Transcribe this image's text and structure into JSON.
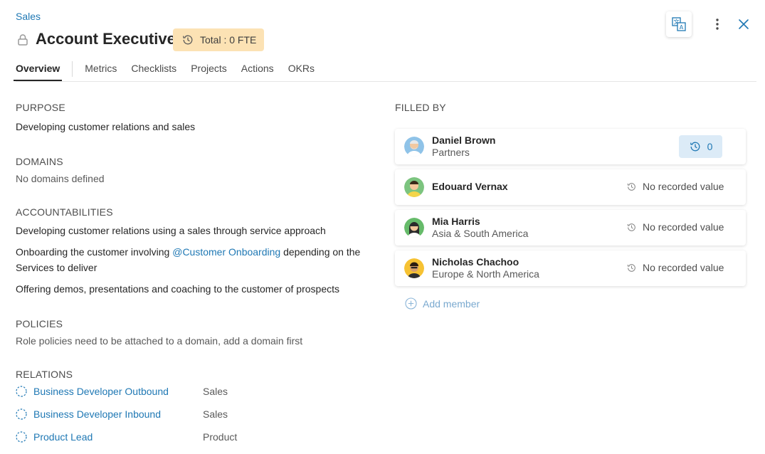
{
  "header": {
    "breadcrumb": "Sales",
    "title": "Account Executive",
    "fte_badge": "Total : 0 FTE"
  },
  "tabs": [
    {
      "label": "Overview",
      "active": true
    },
    {
      "label": "Metrics"
    },
    {
      "label": "Checklists"
    },
    {
      "label": "Projects"
    },
    {
      "label": "Actions"
    },
    {
      "label": "OKRs"
    }
  ],
  "purpose": {
    "heading": "PURPOSE",
    "text": "Developing customer relations and sales"
  },
  "domains": {
    "heading": "DOMAINS",
    "text": "No domains defined"
  },
  "accountabilities": {
    "heading": "ACCOUNTABILITIES",
    "item1": "Developing customer relations using a sales through service approach",
    "item2_before": "Onboarding the customer involving ",
    "item2_link": "@Customer Onboarding",
    "item2_after": " depending on the Services to deliver",
    "item3": "Offering demos, presentations and coaching to the customer of prospects"
  },
  "policies": {
    "heading": "POLICIES",
    "text": "Role policies need to be attached to a domain, add a domain first"
  },
  "relations": {
    "heading": "RELATIONS",
    "items": [
      {
        "role": "Business Developer Outbound",
        "circle": "Sales"
      },
      {
        "role": "Business Developer Inbound",
        "circle": "Sales"
      },
      {
        "role": "Product Lead",
        "circle": "Product"
      }
    ]
  },
  "filled_by": {
    "heading": "FILLED BY",
    "members": [
      {
        "name": "Daniel Brown",
        "sub": "Partners",
        "value": "0"
      },
      {
        "name": "Edouard Vernax",
        "sub": "",
        "value_text": "No recorded value"
      },
      {
        "name": "Mia Harris",
        "sub": "Asia & South America",
        "value_text": "No recorded value"
      },
      {
        "name": "Nicholas Chachoo",
        "sub": "Europe & North America",
        "value_text": "No recorded value"
      }
    ],
    "add_member": "Add member"
  },
  "colors": {
    "link": "#1f78b4",
    "badge": "#fce2b4",
    "pill": "#dcebf7"
  }
}
